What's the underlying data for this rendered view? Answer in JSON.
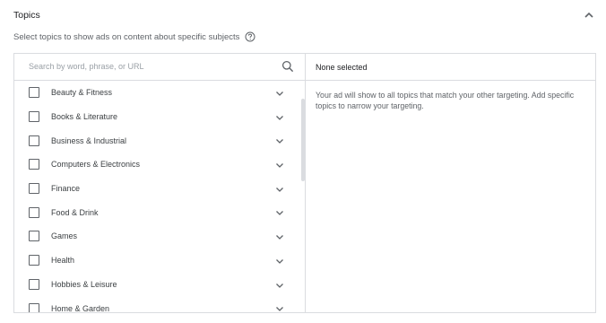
{
  "header": {
    "title": "Topics"
  },
  "description": "Select topics to show ads on content about specific subjects",
  "search": {
    "placeholder": "Search by word, phrase, or URL"
  },
  "topics": [
    {
      "label": "Beauty & Fitness"
    },
    {
      "label": "Books & Literature"
    },
    {
      "label": "Business & Industrial"
    },
    {
      "label": "Computers & Electronics"
    },
    {
      "label": "Finance"
    },
    {
      "label": "Food & Drink"
    },
    {
      "label": "Games"
    },
    {
      "label": "Health"
    },
    {
      "label": "Hobbies & Leisure"
    },
    {
      "label": "Home & Garden"
    }
  ],
  "selected": {
    "header": "None selected",
    "info": "Your ad will show to all topics that match your other targeting. Add specific topics to narrow your targeting."
  },
  "icons": {
    "collapse": "chevron-up-icon",
    "help": "help-circle-icon",
    "search": "search-icon",
    "expand": "chevron-down-icon"
  },
  "colors": {
    "border": "#dadce0",
    "text": "#3c4043",
    "muted": "#5f6368",
    "checkbox": "#5f6368"
  }
}
